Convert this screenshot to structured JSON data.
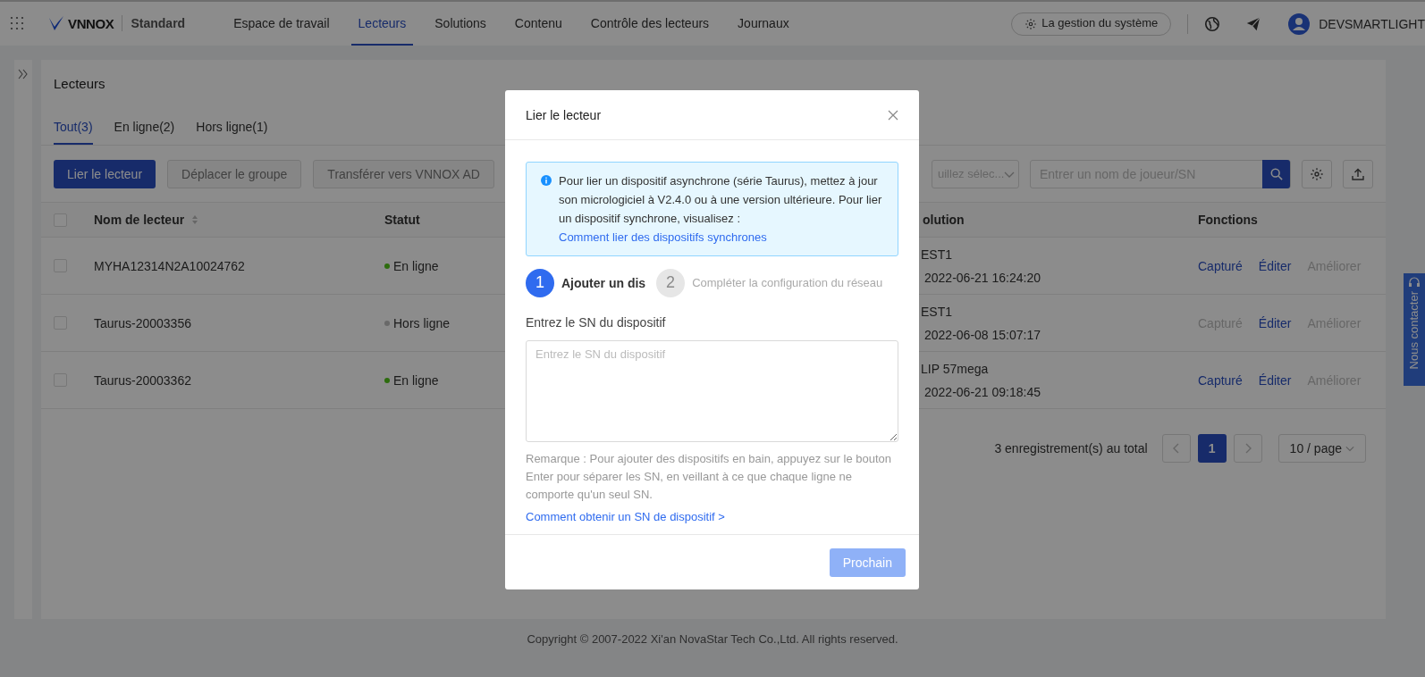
{
  "header": {
    "brand": "VNNOX",
    "edition": "Standard",
    "nav": [
      {
        "label": "Espace de travail",
        "selected": false
      },
      {
        "label": "Lecteurs",
        "selected": true
      },
      {
        "label": "Solutions",
        "selected": false
      },
      {
        "label": "Contenu",
        "selected": false
      },
      {
        "label": "Contrôle des lecteurs",
        "selected": false
      },
      {
        "label": "Journaux",
        "selected": false
      }
    ],
    "system_button": "La gestion du système",
    "user": "DEVSMARTLIGHT"
  },
  "page": {
    "title": "Lecteurs",
    "tabs": [
      {
        "label": "Tout(3)",
        "selected": true
      },
      {
        "label": "En ligne(2)",
        "selected": false
      },
      {
        "label": "Hors ligne(1)",
        "selected": false
      }
    ],
    "toolbar": {
      "buttons": [
        {
          "label": "Lier le lecteur",
          "disabled": false
        },
        {
          "label": "Déplacer le groupe",
          "disabled": true
        },
        {
          "label": "Transférer vers VNNOX AD",
          "disabled": true
        }
      ],
      "select_placeholder": "uillez sélec...",
      "search_placeholder": "Entrer un nom de joueur/SN"
    },
    "table": {
      "header_checked": false,
      "columns": [
        "Nom de lecteur",
        "Statut",
        "olution",
        "Fonctions"
      ],
      "rows": [
        {
          "checked": false,
          "name": "MYHA12314N2A10024762",
          "status": "En ligne",
          "color": "#2d6c0e",
          "solution": "EST1",
          "time": "2022-06-21 16:24:20",
          "actions": [
            {
              "label": "Capturé",
              "disabled": false
            },
            {
              "label": "Éditer",
              "disabled": false
            },
            {
              "label": "Améliorer",
              "disabled": true
            }
          ]
        },
        {
          "checked": false,
          "name": "Taurus-20003356",
          "status": "Hors ligne",
          "color": "#696969",
          "solution": "EST1",
          "time": "2022-06-08 15:07:17",
          "actions": [
            {
              "label": "Capturé",
              "disabled": true
            },
            {
              "label": "Éditer",
              "disabled": false
            },
            {
              "label": "Améliorer",
              "disabled": true
            }
          ]
        },
        {
          "checked": false,
          "name": "Taurus-20003362",
          "status": "En ligne",
          "color": "#2d6c0e",
          "solution": "LIP 57mega",
          "time": "2022-06-21 09:18:45",
          "actions": [
            {
              "label": "Capturé",
              "disabled": false
            },
            {
              "label": "Éditer",
              "disabled": false
            },
            {
              "label": "Améliorer",
              "disabled": true
            }
          ]
        }
      ]
    },
    "pagination": {
      "total": "3 enregistrement(s) au total",
      "pages": [
        {
          "label": "1",
          "selected": true
        }
      ],
      "page_size": "10 / page"
    }
  },
  "footer": "Copyright © 2007-2022 Xi'an NovaStar Tech Co.,Ltd. All rights reserved.",
  "contact_tab": "Nous contacter",
  "dialog": {
    "title": "Lier le lecteur",
    "info": {
      "text": "Pour lier un dispositif asynchrone (série Taurus), mettez à jour son micrologiciel à V2.4.0 ou à une version ultérieure. Pour lier un dispositif synchrone, visualisez :",
      "link": "Comment lier des dispositifs synchrones"
    },
    "steps": [
      {
        "number": "1",
        "label": "Ajouter un dis",
        "selected": true
      },
      {
        "number": "2",
        "label": "Compléter la configuration du réseau",
        "selected": false
      }
    ],
    "field_label": "Entrez le SN du dispositif",
    "placeholder": "Entrez le SN du dispositif",
    "note": "Remarque : Pour ajouter des dispositifs en bain, appuyez sur le bouton Enter pour séparer les SN, en veillant à ce que chaque ligne ne comporte qu'un seul SN.",
    "help_link": "Comment obtenir un SN de dispositif >",
    "next_button": {
      "label": "Prochain",
      "disabled": true
    }
  }
}
